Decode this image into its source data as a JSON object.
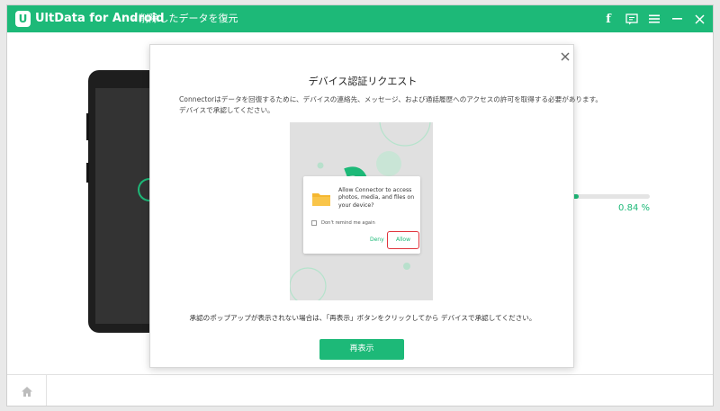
{
  "app": {
    "logo_letter": "U",
    "title": "UltData for Android",
    "subtitle": "- 削除したデータを復元"
  },
  "titlebar_buttons": {
    "facebook_glyph": "f",
    "icons": [
      "facebook-icon",
      "chat-icon",
      "menu-icon",
      "minimize-icon",
      "close-icon"
    ]
  },
  "background": {
    "progress_fraction": 0.0084,
    "progress_text": "0.84 %"
  },
  "dialog": {
    "title": "デバイス認証リクエスト",
    "description_line1": "Connectorはデータを回復するために、デバイスの連絡先、メッセージ、および通話履歴へのアクセスの許可を取得する必要があります。",
    "description_line2": "デバイスで承認してください。",
    "permission": {
      "message": "Allow Connector to access photos, media, and files on your device?",
      "checkbox_label": "Don't remind me again",
      "deny_label": "Deny",
      "allow_label": "Allow"
    },
    "note": "承認のポップアップが表示されない場合は、「再表示」ボタンをクリックしてから デバイスで承認してください。",
    "button_label": "再表示"
  },
  "colors": {
    "accent": "#1db978",
    "highlight_border": "#e0343c",
    "folder": "#f5b731"
  }
}
